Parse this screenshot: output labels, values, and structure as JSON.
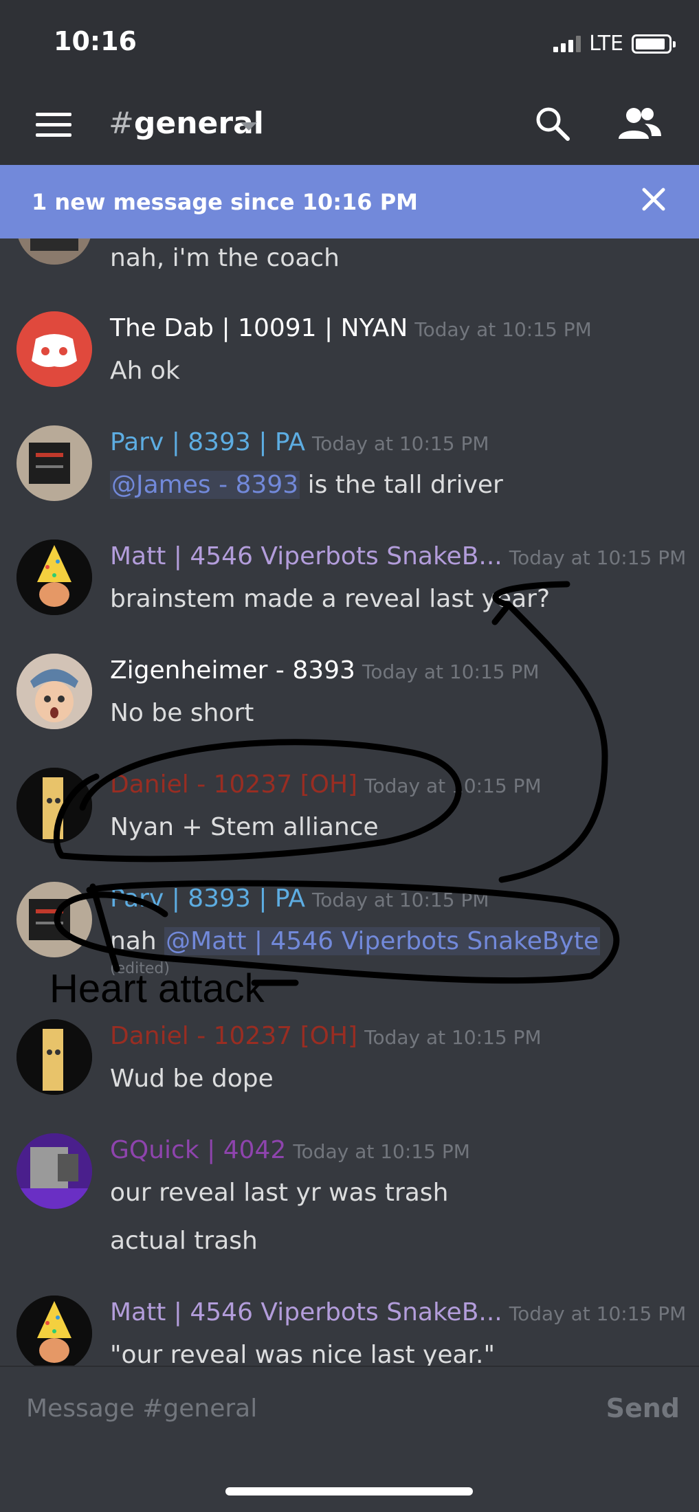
{
  "status_bar": {
    "time": "10:16",
    "network": "LTE"
  },
  "header": {
    "hash": "#",
    "channel": "general"
  },
  "banner": {
    "text": "1 new message since 10:16 PM"
  },
  "messages": [
    {
      "author": "",
      "timestamp": "",
      "text": "nah, i'm the coach"
    },
    {
      "author": "The Dab | 10091 | NYAN",
      "timestamp": "Today at 10:15 PM",
      "text": "Ah ok",
      "author_color": "#ffffff"
    },
    {
      "author": "Parv | 8393 | PA",
      "timestamp": "Today at 10:15 PM",
      "mention": "@James - 8393",
      "text": " is the tall driver",
      "author_color": "#5dade2"
    },
    {
      "author": "Matt | 4546 Viperbots SnakeB...",
      "timestamp": "Today at 10:15 PM",
      "text": "brainstem made a reveal last year?",
      "author_color": "#b39ddb"
    },
    {
      "author": "Zigenheimer - 8393",
      "timestamp": "Today at 10:15 PM",
      "text": "No be short",
      "author_color": "#ffffff"
    },
    {
      "author": "Daniel - 10237 [OH]",
      "timestamp": "Today at 10:15 PM",
      "text": "Nyan + Stem alliance",
      "author_color": "#992d22"
    },
    {
      "author": "Parv | 8393 | PA",
      "timestamp": "Today at 10:15 PM",
      "text_prefix": "nah ",
      "mention": "@Matt | 4546 Viperbots SnakeByte",
      "edited": "(edited)",
      "author_color": "#5dade2"
    },
    {
      "author": "Daniel - 10237 [OH]",
      "timestamp": "Today at 10:15 PM",
      "text": "Wud be dope",
      "author_color": "#992d22"
    },
    {
      "author": "GQuick | 4042",
      "timestamp": "Today at 10:15 PM",
      "text": "our reveal last yr was trash",
      "text2": "actual trash",
      "author_color": "#8e44ad"
    },
    {
      "author": "Matt | 4546 Viperbots SnakeB...",
      "timestamp": "Today at 10:15 PM",
      "text": "\"our reveal was nice last year.\"",
      "author_color": "#b39ddb"
    }
  ],
  "annotation": {
    "text": "Heart attack"
  },
  "composer": {
    "placeholder": "Message #general",
    "send_label": "Send"
  },
  "icons": [
    "menu-icon",
    "search-icon",
    "members-icon",
    "close-icon",
    "discord-logo-icon"
  ],
  "colors": {
    "background": "#36393f",
    "header": "#2f3136",
    "banner": "#7289da",
    "mention": "#7289da"
  }
}
